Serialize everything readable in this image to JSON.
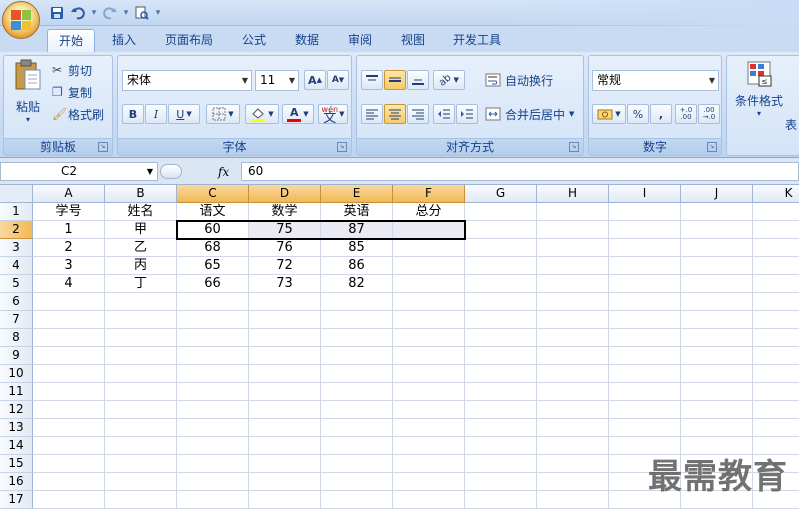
{
  "quick_access": {
    "icons": [
      "save-icon",
      "undo-icon",
      "redo-icon",
      "print-preview-icon",
      "customize-icon"
    ]
  },
  "tabs": [
    {
      "label": "开始",
      "active": true
    },
    {
      "label": "插入"
    },
    {
      "label": "页面布局"
    },
    {
      "label": "公式"
    },
    {
      "label": "数据"
    },
    {
      "label": "审阅"
    },
    {
      "label": "视图"
    },
    {
      "label": "开发工具"
    }
  ],
  "clipboard": {
    "group": "剪贴板",
    "paste": "粘贴",
    "cut": "剪切",
    "copy": "复制",
    "format_painter": "格式刷"
  },
  "font": {
    "group": "字体",
    "name": "宋体",
    "size": "11",
    "bold": "B",
    "italic": "I",
    "underline": "U",
    "wen": "wén",
    "wen_char": "文",
    "grow": "A",
    "shrink": "A"
  },
  "alignment": {
    "group": "对齐方式",
    "wrap": "自动换行",
    "merge": "合并后居中"
  },
  "number": {
    "group": "数字",
    "format": "常规",
    "percent": "%",
    "comma": ",",
    "inc": "+.0\n.00",
    "dec": ".00\n→.0"
  },
  "styles": {
    "cond_format": "条件格式",
    "table": "表"
  },
  "formula_bar": {
    "namebox": "C2",
    "fx": "fx",
    "value": "60"
  },
  "columns": [
    "A",
    "B",
    "C",
    "D",
    "E",
    "F",
    "G",
    "H",
    "I",
    "J",
    "K"
  ],
  "selected_columns": [
    "C",
    "D",
    "E",
    "F"
  ],
  "rows": [
    "1",
    "2",
    "3",
    "4",
    "5",
    "6",
    "7",
    "8",
    "9",
    "10",
    "11",
    "12",
    "13",
    "14",
    "15",
    "16",
    "17"
  ],
  "selected_row": "2",
  "sheet": {
    "headers": [
      "学号",
      "姓名",
      "语文",
      "数学",
      "英语",
      "总分"
    ],
    "data": [
      [
        "1",
        "甲",
        "60",
        "75",
        "87",
        ""
      ],
      [
        "2",
        "乙",
        "68",
        "76",
        "85",
        ""
      ],
      [
        "3",
        "丙",
        "65",
        "72",
        "86",
        ""
      ],
      [
        "4",
        "丁",
        "66",
        "73",
        "82",
        ""
      ]
    ]
  },
  "watermark": "最需教育",
  "colors": {
    "accent": "#15428b",
    "selection_header": "#f1b955"
  }
}
